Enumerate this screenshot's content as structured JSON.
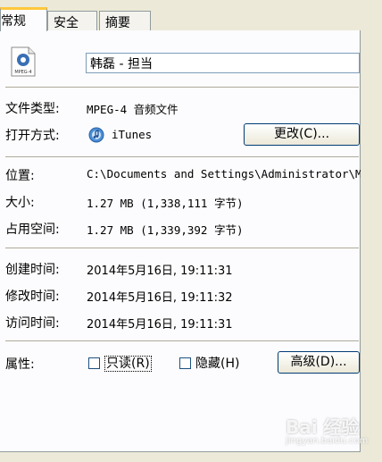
{
  "tabs": [
    {
      "label": "常规",
      "active": true
    },
    {
      "label": "安全",
      "active": false
    },
    {
      "label": "摘要",
      "active": false
    }
  ],
  "file": {
    "icon_label": "MPEG-4",
    "name": "韩磊 - 担当"
  },
  "type_row": {
    "label": "文件类型:",
    "value": "MPEG-4 音频文件"
  },
  "open_row": {
    "label": "打开方式:",
    "app": "iTunes",
    "change_button": "更改(C)..."
  },
  "location_row": {
    "label": "位置:",
    "value": "C:\\Documents and Settings\\Administrator\\M"
  },
  "size_row": {
    "label": "大小:",
    "value": "1.27 MB (1,338,111 字节)"
  },
  "disk_row": {
    "label": "占用空间:",
    "value": "1.27 MB (1,339,392 字节)"
  },
  "created_row": {
    "label": "创建时间:",
    "value": "2014年5月16日, 19:11:31"
  },
  "modified_row": {
    "label": "修改时间:",
    "value": "2014年5月16日, 19:11:32"
  },
  "accessed_row": {
    "label": "访问时间:",
    "value": "2014年5月16日, 19:11:31"
  },
  "attributes": {
    "label": "属性:",
    "readonly_label": "只读(R)",
    "readonly_checked": false,
    "hidden_label": "隐藏(H)",
    "hidden_checked": false,
    "advanced_button": "高级(D)..."
  },
  "watermark": {
    "brand": "Bai 经验",
    "url": "jingyan.baidu.com"
  },
  "colors": {
    "accent_tab": "#ffc83c",
    "panel_bg": "#fcfcfe",
    "window_bg": "#ece9d8"
  }
}
